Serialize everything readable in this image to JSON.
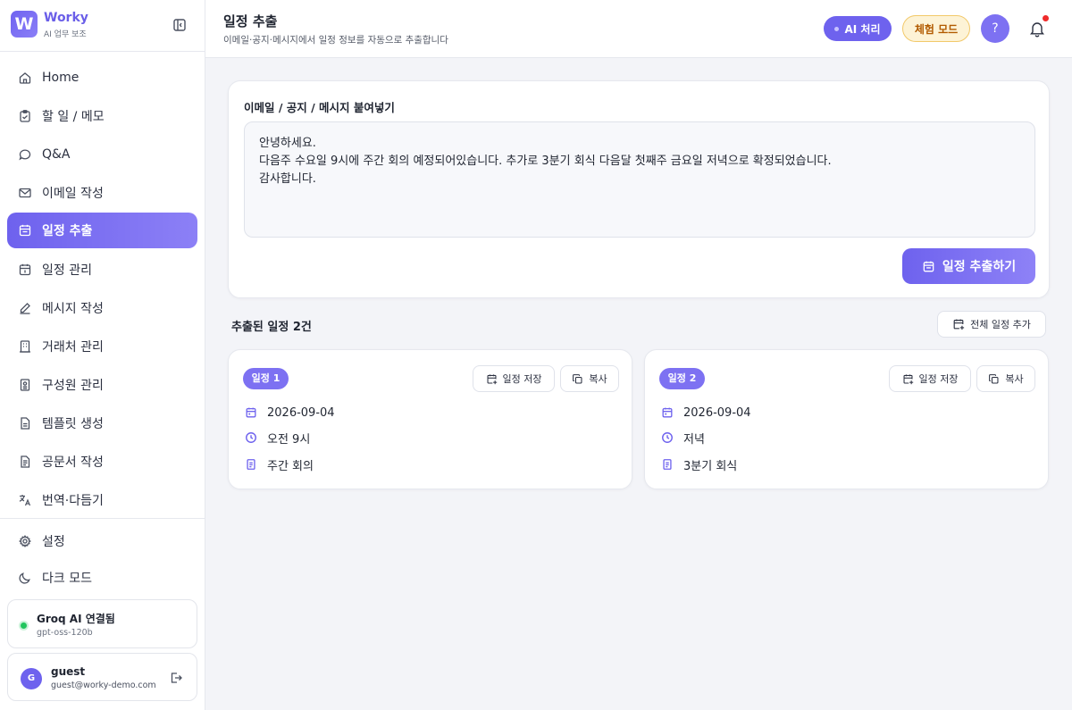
{
  "brand": {
    "name": "Worky",
    "logo_letter": "W",
    "subtitle": "AI 업무 보조"
  },
  "sidebar": {
    "items": [
      {
        "label": "Home",
        "icon": "home-icon"
      },
      {
        "label": "할 일 / 메모",
        "icon": "clipboard-icon"
      },
      {
        "label": "Q&A",
        "icon": "chat-icon"
      },
      {
        "label": "이메일 작성",
        "icon": "mail-icon"
      },
      {
        "label": "일정 추출",
        "icon": "calendar-icon",
        "active": true
      },
      {
        "label": "일정 관리",
        "icon": "calendar-check-icon"
      },
      {
        "label": "메시지 작성",
        "icon": "pencil-icon"
      },
      {
        "label": "거래처 관리",
        "icon": "building-icon"
      },
      {
        "label": "구성원 관리",
        "icon": "id-card-icon"
      },
      {
        "label": "템플릿 생성",
        "icon": "file-icon"
      },
      {
        "label": "공문서 작성",
        "icon": "document-icon"
      },
      {
        "label": "번역·다듬기",
        "icon": "translate-icon"
      }
    ],
    "bottom_items": [
      {
        "label": "설정",
        "icon": "gear-icon"
      },
      {
        "label": "다크 모드",
        "icon": "moon-icon"
      }
    ],
    "ai_status": {
      "title": "Groq AI 연결됨",
      "model": "gpt-oss-120b",
      "color": "#22c55e"
    },
    "user": {
      "initial": "G",
      "name": "guest",
      "email": "guest@worky-demo.com"
    }
  },
  "header": {
    "title": "일정 추출",
    "subtitle": "이메일·공지·메시지에서 일정 정보를 자동으로 추출합니다",
    "ai_badge": "AI 처리",
    "trial_badge": "체험 모드",
    "help": "?"
  },
  "input": {
    "label": "이메일 / 공지 / 메시지 붙여넣기",
    "lines": [
      "안녕하세요.",
      "다음주 수요일 9시에 주간 회의 예정되어있습니다. 추가로 3분기 회식 다음달 첫째주 금요일 저녁으로 확정되었습니다.",
      "감사합니다."
    ],
    "button": "일정 추출하기"
  },
  "results": {
    "title": "추출된 일정 2건",
    "add_all": "전체 일정 추가",
    "events": [
      {
        "badge": "일정 1",
        "date": "2026-09-04",
        "time": "오전 9시",
        "title": "주간 회의",
        "save": "일정 저장",
        "copy": "복사"
      },
      {
        "badge": "일정 2",
        "date": "2026-09-04",
        "time": "저녁",
        "title": "3분기 회식",
        "save": "일정 저장",
        "copy": "복사"
      }
    ]
  },
  "colors": {
    "accent": "#6e62ee",
    "trial": "#b25b00",
    "notification": "#ef2b2b"
  }
}
